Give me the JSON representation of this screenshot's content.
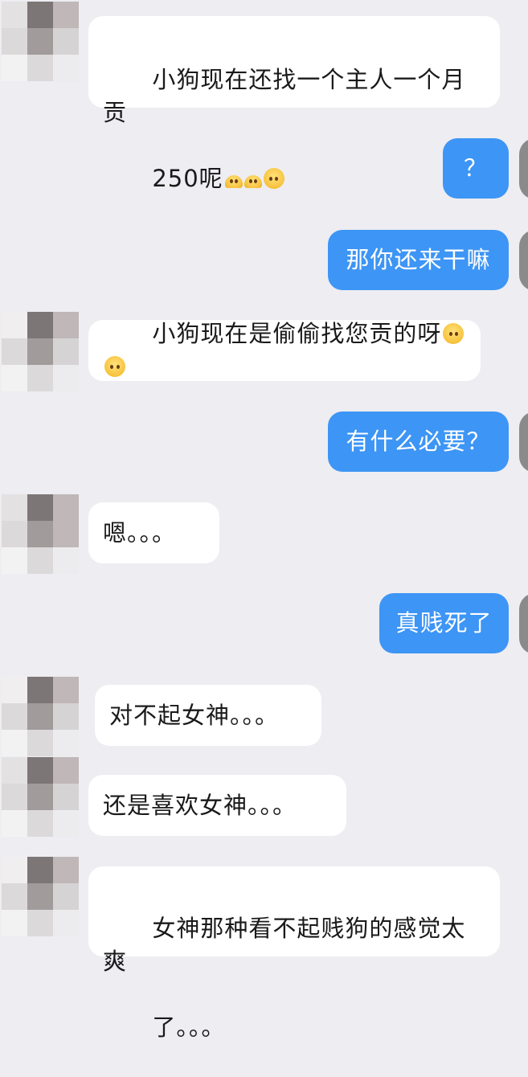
{
  "messages": [
    {
      "side": "left",
      "line1": "小狗现在还找一个主人一个月贡",
      "line2": "250呢",
      "emoji_after": [
        "melting-eyes",
        "melting-eyes",
        "pleading-hands"
      ]
    },
    {
      "side": "right",
      "text": "？"
    },
    {
      "side": "right",
      "text": "那你还来干嘛"
    },
    {
      "side": "left",
      "text": "小狗现在是偷偷找您贡的呀",
      "emoji_after": [
        "pleading-hands",
        "pleading-hands"
      ]
    },
    {
      "side": "right",
      "text": "有什么必要？"
    },
    {
      "side": "left",
      "text": "嗯。。。"
    },
    {
      "side": "right",
      "text": "真贱死了"
    },
    {
      "side": "left",
      "text": "对不起女神。。。"
    },
    {
      "side": "left",
      "text": "还是喜欢女神。。。"
    },
    {
      "side": "left",
      "line1": "女神那种看不起贱狗的感觉太爽",
      "line2": "了。。。"
    }
  ],
  "colors": {
    "background": "#ededf2",
    "incoming_bubble": "#ffffff",
    "outgoing_bubble": "#3d95f5",
    "incoming_text": "#1a1a1a",
    "outgoing_text": "#ffffff"
  },
  "icons": {
    "avatar": "blurred-avatar",
    "emoji_a": "melting-eyes-emoji",
    "emoji_b": "pleading-hands-emoji"
  }
}
